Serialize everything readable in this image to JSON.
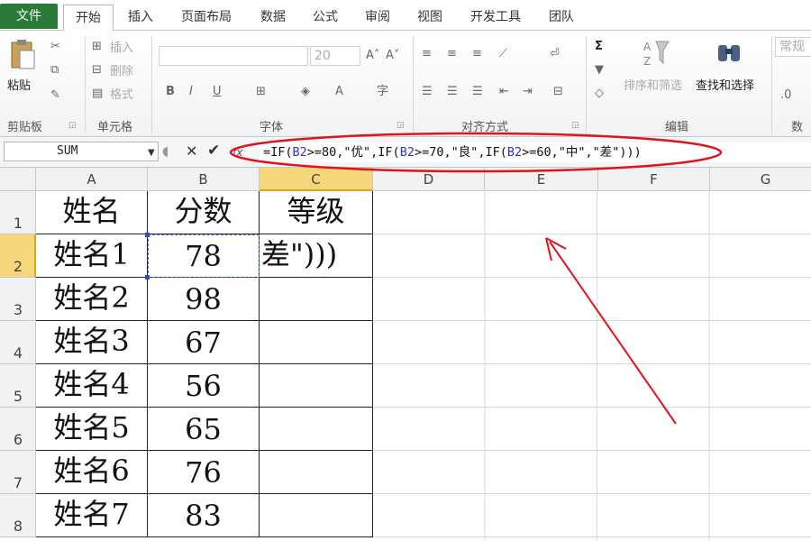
{
  "tabs": [
    {
      "label": "文件"
    },
    {
      "label": "开始"
    },
    {
      "label": "插入"
    },
    {
      "label": "页面布局"
    },
    {
      "label": "数据"
    },
    {
      "label": "公式"
    },
    {
      "label": "审阅"
    },
    {
      "label": "视图"
    },
    {
      "label": "开发工具"
    },
    {
      "label": "团队"
    }
  ],
  "ribbon": {
    "clipboard": {
      "paste": "粘贴",
      "group": "剪贴板"
    },
    "cells": {
      "insert": "插入",
      "delete": "删除",
      "format": "格式",
      "group": "单元格"
    },
    "font": {
      "size": "20",
      "group": "字体"
    },
    "alignment": {
      "group": "对齐方式"
    },
    "editing": {
      "sort_filter": "排序和筛选",
      "find_select": "查找和选择",
      "group": "编辑"
    },
    "number": {
      "format": "常规",
      "group": "数字"
    }
  },
  "formula_bar": {
    "name_box": "SUM",
    "fx": "fx",
    "formula_parts": [
      "=IF(",
      "B2",
      ">=80,\"优\",IF(",
      "B2",
      ">=70,\"良\",IF(",
      "B2",
      ">=60,\"中\",\"差\")))"
    ]
  },
  "sheet": {
    "columns": [
      "A",
      "B",
      "C",
      "D",
      "E",
      "F",
      "G"
    ],
    "rows": [
      "1",
      "2",
      "3",
      "4",
      "5",
      "6",
      "7",
      "8"
    ],
    "cells": [
      [
        "姓名",
        "分数",
        "等级"
      ],
      [
        "姓名1",
        "78",
        "差\")))"
      ],
      [
        "姓名2",
        "98",
        ""
      ],
      [
        "姓名3",
        "67",
        ""
      ],
      [
        "姓名4",
        "56",
        ""
      ],
      [
        "姓名5",
        "65",
        ""
      ],
      [
        "姓名6",
        "76",
        ""
      ],
      [
        "姓名7",
        "83",
        ""
      ]
    ],
    "selected_cell": "C2"
  },
  "annotation": {
    "color": "#e0141c"
  }
}
